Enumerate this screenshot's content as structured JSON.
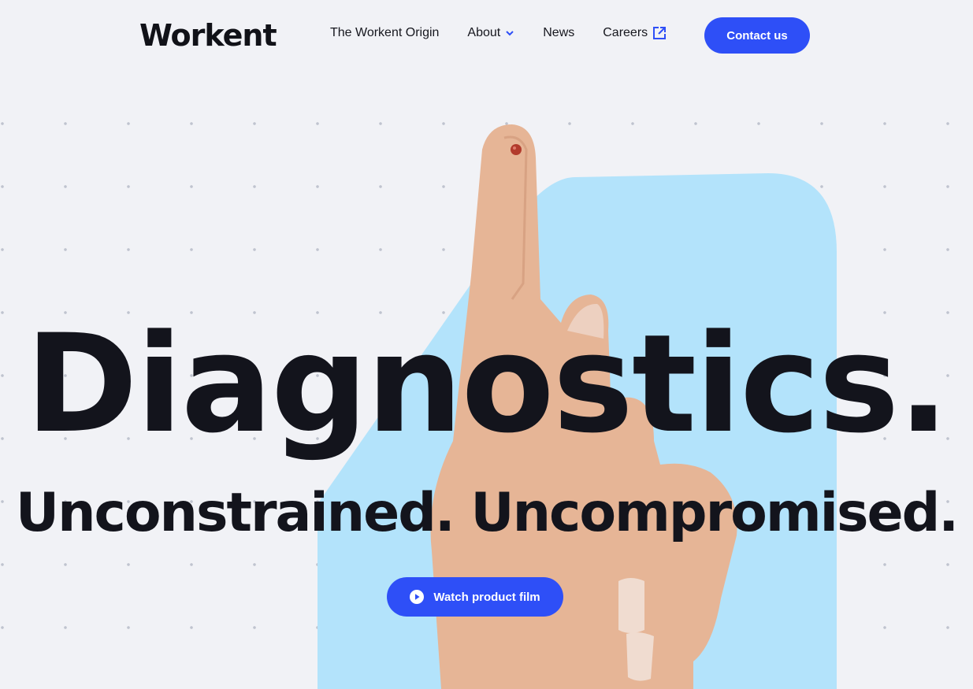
{
  "header": {
    "logo": "Workent",
    "nav": [
      {
        "label": "The Workent Origin"
      },
      {
        "label": "About",
        "icon": "chevron-down-icon"
      },
      {
        "label": "News"
      },
      {
        "label": "Careers",
        "icon": "external-link-icon"
      }
    ],
    "contact_label": "Contact us"
  },
  "hero": {
    "title": "Diagnostics.",
    "subtitle": "Unconstrained. Uncompromised.",
    "cta_label": "Watch product film",
    "cta_icon": "play-circle-icon"
  },
  "colors": {
    "accent": "#2e4ff7",
    "background": "#f1f2f6",
    "shape": "#b3e3fb",
    "text": "#13141c"
  }
}
